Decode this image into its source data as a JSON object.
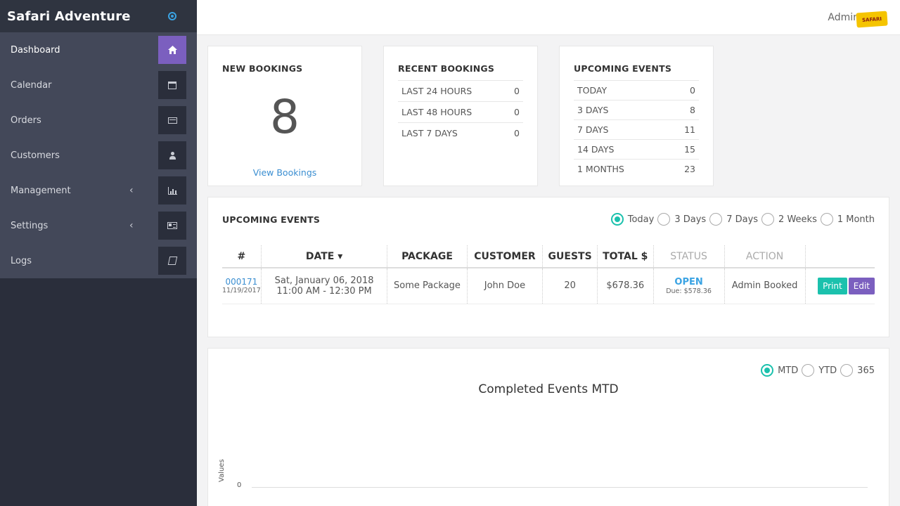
{
  "app": {
    "title": "Safari Adventure"
  },
  "sidebar": {
    "items": [
      {
        "label": "Dashboard",
        "icon": "home-icon",
        "active": true
      },
      {
        "label": "Calendar",
        "icon": "calendar-icon"
      },
      {
        "label": "Orders",
        "icon": "credit-card-icon"
      },
      {
        "label": "Customers",
        "icon": "user-icon"
      },
      {
        "label": "Management",
        "icon": "bar-chart-icon",
        "expand": "‹"
      },
      {
        "label": "Settings",
        "icon": "id-card-icon",
        "expand": "‹"
      },
      {
        "label": "Logs",
        "icon": "book-icon"
      }
    ]
  },
  "header": {
    "user_label": "Admin",
    "logo_text": "Safari"
  },
  "new_bookings": {
    "title": "NEW BOOKINGS",
    "count": "8",
    "link": "View Bookings"
  },
  "recent_bookings": {
    "title": "RECENT BOOKINGS",
    "rows": [
      {
        "label": "LAST 24 HOURS",
        "value": "0"
      },
      {
        "label": "LAST 48 HOURS",
        "value": "0"
      },
      {
        "label": "LAST 7 DAYS",
        "value": "0"
      }
    ]
  },
  "upcoming_summary": {
    "title": "UPCOMING EVENTS",
    "rows": [
      {
        "label": "TODAY",
        "value": "0"
      },
      {
        "label": "3 DAYS",
        "value": "8"
      },
      {
        "label": "7 DAYS",
        "value": "11"
      },
      {
        "label": "14 DAYS",
        "value": "15"
      },
      {
        "label": "1 MONTHS",
        "value": "23"
      }
    ]
  },
  "events": {
    "title": "UPCOMING EVENTS",
    "filters": [
      "Today",
      "3 Days",
      "7 Days",
      "2 Weeks",
      "1 Month"
    ],
    "selected_filter": "Today",
    "columns": [
      "#",
      "DATE",
      "PACKAGE",
      "CUSTOMER",
      "GUESTS",
      "TOTAL $",
      "STATUS",
      "ACTION"
    ],
    "sort_indicator": "▾",
    "rows": [
      {
        "id": "000171",
        "order_date": "11/19/2017",
        "date": "Sat, January 06, 2018",
        "time": "11:00 AM - 12:30 PM",
        "package": "Some Package",
        "customer": "John Doe",
        "guests": "20",
        "total": "$678.36",
        "status": "OPEN",
        "due": "Due: $578.36",
        "action": "Admin Booked",
        "print_label": "Print",
        "edit_label": "Edit"
      }
    ]
  },
  "completed": {
    "filters": [
      "MTD",
      "YTD",
      "365"
    ],
    "selected_filter": "MTD"
  },
  "chart_data": {
    "type": "line",
    "title": "Completed Events MTD",
    "ylabel": "Values",
    "xlabel": "",
    "y_ticks": [
      "0"
    ],
    "series": []
  },
  "colors": {
    "accent_purple": "#7b5fbf",
    "accent_teal": "#1bc1ad",
    "link_blue": "#3a8ed1",
    "sidebar_bg": "#2a2e3b"
  }
}
